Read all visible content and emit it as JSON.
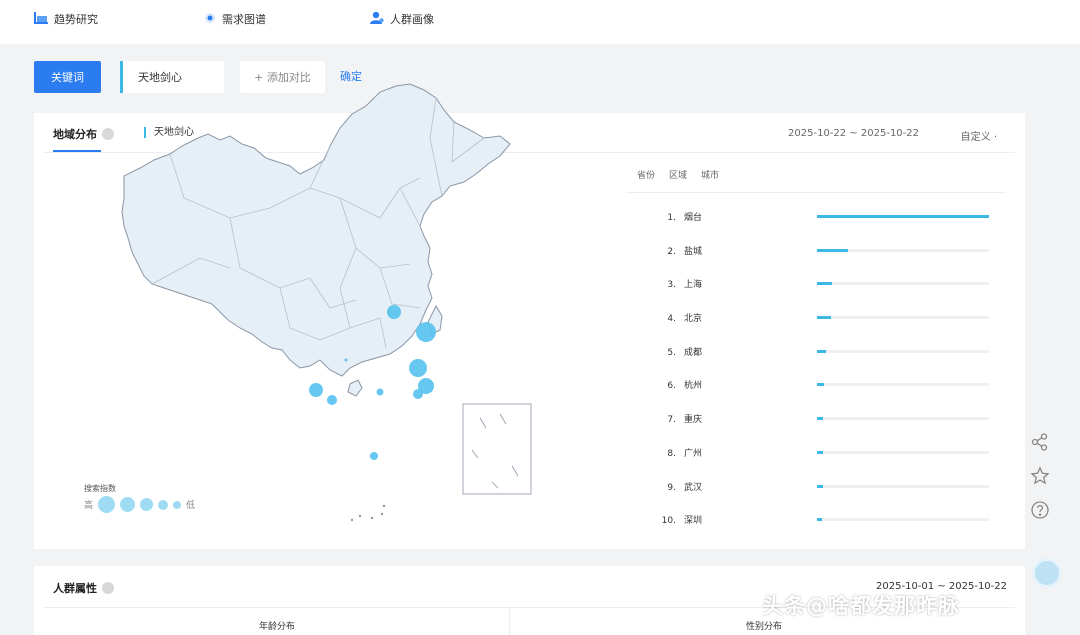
{
  "nav": {
    "items": [
      {
        "label": "趋势研究",
        "icon": "chart-icon"
      },
      {
        "label": "需求图谱",
        "icon": "radio-icon"
      },
      {
        "label": "人群画像",
        "icon": "user-icon"
      }
    ]
  },
  "search": {
    "keyword_button": "关键词",
    "keyword_value": "天地剑心",
    "add_compare": "+ 添加对比",
    "confirm": "确定"
  },
  "region": {
    "tab_label": "地域分布",
    "series_label": "天地剑心",
    "date_range": "2025-10-22 ~ 2025-10-22",
    "custom_label": "自定义",
    "rank_tabs": [
      "省份",
      "区域",
      "城市"
    ],
    "legend_title": "搜索指数",
    "legend_high": "高",
    "legend_low": "低",
    "accent_color": "#3bb8e6",
    "rankings": [
      {
        "rank": "1.",
        "city": "烟台",
        "value": 1.0
      },
      {
        "rank": "2.",
        "city": "盐城",
        "value": 0.18
      },
      {
        "rank": "3.",
        "city": "上海",
        "value": 0.09
      },
      {
        "rank": "4.",
        "city": "北京",
        "value": 0.08
      },
      {
        "rank": "5.",
        "city": "成都",
        "value": 0.05
      },
      {
        "rank": "6.",
        "city": "杭州",
        "value": 0.04
      },
      {
        "rank": "7.",
        "city": "重庆",
        "value": 0.035
      },
      {
        "rank": "8.",
        "city": "广州",
        "value": 0.035
      },
      {
        "rank": "9.",
        "city": "武汉",
        "value": 0.035
      },
      {
        "rank": "10.",
        "city": "深圳",
        "value": 0.03
      }
    ]
  },
  "crowd": {
    "title": "人群属性",
    "date_range": "2025-10-01 ~ 2025-10-22",
    "age_label": "年龄分布",
    "gender_label": "性别分布"
  },
  "side_tools": [
    "share-icon",
    "star-icon",
    "help-icon"
  ],
  "watermark": "头条@啥都发那昨脉"
}
